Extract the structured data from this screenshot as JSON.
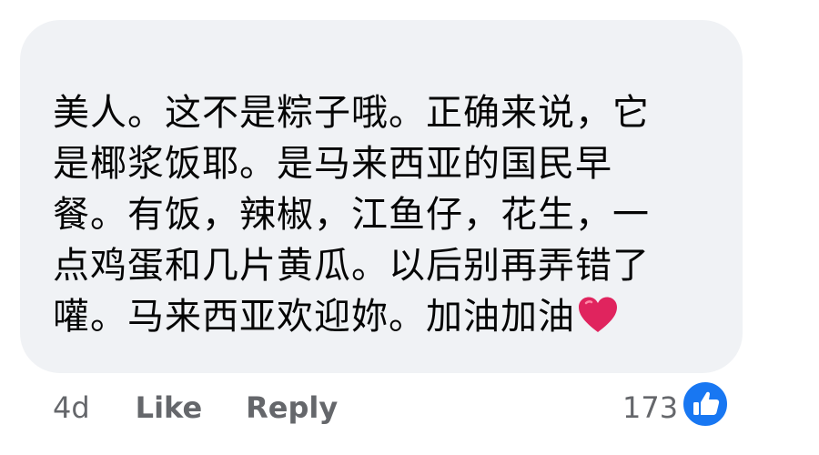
{
  "comment": {
    "lines": [
      "美人。这不是粽子哦。正确来说，它",
      "是椰浆饭耶。是马来西亚的国民早",
      "餐。有饭，辣椒，江鱼仔，花生，一",
      "点鸡蛋和几片黄瓜。以后别再弄错了",
      "嚾。马来西亚欢迎妳。加油加油"
    ],
    "emoji": "red-heart-icon"
  },
  "actions": {
    "timestamp": "4d",
    "like_label": "Like",
    "reply_label": "Reply"
  },
  "reactions": {
    "count": "173",
    "icon": "thumbs-up-icon",
    "icon_color": "#1877f2"
  },
  "colors": {
    "bubble_bg": "#f0f2f5",
    "text": "#050505",
    "meta_text": "#65676b",
    "heart": "#e0245e"
  }
}
